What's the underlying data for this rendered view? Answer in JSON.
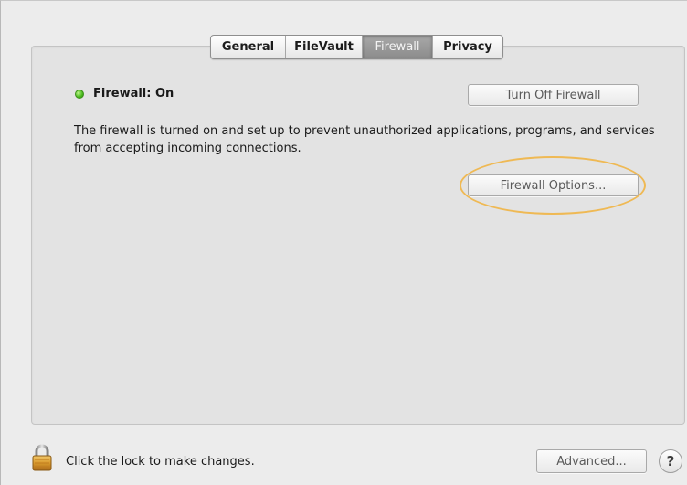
{
  "tabs": {
    "general": "General",
    "filevault": "FileVault",
    "firewall": "Firewall",
    "privacy": "Privacy",
    "selected": "Firewall"
  },
  "firewall": {
    "status_label": "Firewall: On",
    "status_color": "#4aba1e",
    "turn_off_button": "Turn Off Firewall",
    "description": "The firewall is turned on and set up to prevent unauthorized applications, programs, and services from accepting incoming connections.",
    "options_button": "Firewall Options...",
    "highlight_color": "#efb954"
  },
  "footer": {
    "lock_icon": "padlock-icon",
    "lock_label": "Click the lock to make changes.",
    "advanced_button": "Advanced...",
    "help_button": "?"
  }
}
